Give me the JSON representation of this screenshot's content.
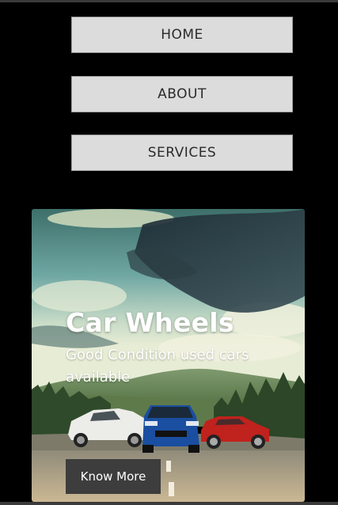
{
  "nav": {
    "home_label": "HOME",
    "about_label": "ABOUT",
    "services_label": "SERVICES"
  },
  "hero": {
    "title": "Car Wheels",
    "subtitle": "Good Condition used cars available",
    "cta_label": "Know More",
    "image_name": "cars-on-mountain-road-photo"
  },
  "colors": {
    "background": "#000000",
    "nav_button_bg": "#dcdcdc",
    "nav_button_text": "#2b2b2b",
    "cta_bg": "#3d3d3d",
    "hero_text": "#ffffff"
  }
}
